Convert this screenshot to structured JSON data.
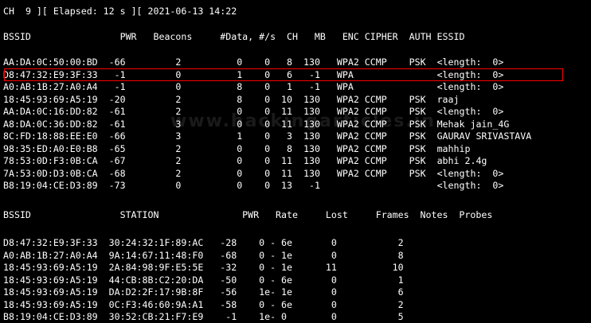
{
  "status": {
    "channel_label": "CH",
    "channel": "9",
    "elapsed_label": "Elapsed:",
    "elapsed": "12 s",
    "timestamp": "2021-06-13 14:22"
  },
  "ap_table": {
    "headers": [
      "BSSID",
      "PWR",
      "Beacons",
      "#Data,",
      "#/s",
      "CH",
      "MB",
      "ENC",
      "CIPHER",
      "AUTH",
      "ESSID"
    ],
    "rows": [
      [
        "AA:DA:0C:50:00:BD",
        "-66",
        "2",
        "0",
        "0",
        "8",
        "130",
        "WPA2",
        "CCMP",
        "PSK",
        "<length:  0>"
      ],
      [
        "D8:47:32:E9:3F:33",
        "-1",
        "0",
        "1",
        "0",
        "6",
        "-1",
        "WPA",
        "",
        "",
        "<length:  0>"
      ],
      [
        "A0:AB:1B:27:A0:A4",
        "-1",
        "0",
        "8",
        "0",
        "1",
        "-1",
        "WPA",
        "",
        "",
        "<length:  0>"
      ],
      [
        "18:45:93:69:A5:19",
        "-20",
        "2",
        "8",
        "0",
        "10",
        "130",
        "WPA2",
        "CCMP",
        "PSK",
        "raaj"
      ],
      [
        "AA:DA:0C:16:DD:82",
        "-61",
        "2",
        "0",
        "0",
        "11",
        "130",
        "WPA2",
        "CCMP",
        "PSK",
        "<length:  0>"
      ],
      [
        "A8:DA:0C:36:DD:82",
        "-61",
        "3",
        "0",
        "0",
        "11",
        "130",
        "WPA2",
        "CCMP",
        "PSK",
        "Mehak jain_4G"
      ],
      [
        "8C:FD:18:88:EE:E0",
        "-66",
        "3",
        "1",
        "0",
        "3",
        "130",
        "WPA2",
        "CCMP",
        "PSK",
        "GAURAV SRIVASTAVA"
      ],
      [
        "98:35:ED:A0:E0:B8",
        "-65",
        "2",
        "0",
        "0",
        "8",
        "130",
        "WPA2",
        "CCMP",
        "PSK",
        "mahhip"
      ],
      [
        "78:53:0D:F3:0B:CA",
        "-67",
        "2",
        "0",
        "0",
        "11",
        "130",
        "WPA2",
        "CCMP",
        "PSK",
        "abhi 2.4g"
      ],
      [
        "7A:53:0D:D3:0B:CA",
        "-68",
        "2",
        "0",
        "0",
        "11",
        "130",
        "WPA2",
        "CCMP",
        "PSK",
        "<length:  0>"
      ],
      [
        "B8:19:04:CE:D3:89",
        "-73",
        "0",
        "0",
        "0",
        "13",
        "-1",
        "",
        "",
        "",
        "<length:  0>"
      ]
    ]
  },
  "station_table": {
    "headers": [
      "BSSID",
      "STATION",
      "PWR",
      "Rate",
      "Lost",
      "Frames",
      "Notes",
      "Probes"
    ],
    "rows": [
      [
        "D8:47:32:E9:3F:33",
        "30:24:32:1F:89:AC",
        "-28",
        "0 - 6e",
        "0",
        "2"
      ],
      [
        "A0:AB:1B:27:A0:A4",
        "9A:14:67:11:48:F0",
        "-68",
        "0 - 1e",
        "0",
        "8"
      ],
      [
        "18:45:93:69:A5:19",
        "2A:84:98:9F:E5:5E",
        "-32",
        "0 - 1e",
        "11",
        "10"
      ],
      [
        "18:45:93:69:A5:19",
        "44:CB:8B:C2:20:DA",
        "-50",
        "0 - 6e",
        "0",
        "1"
      ],
      [
        "18:45:93:69:A5:19",
        "DA:D2:2F:17:9B:8F",
        "-56",
        "1e- 1e",
        "0",
        "6"
      ],
      [
        "18:45:93:69:A5:19",
        "0C:F3:46:60:9A:A1",
        "-58",
        "0 - 6e",
        "0",
        "2"
      ],
      [
        "B8:19:04:CE:D3:89",
        "30:52:CB:21:F7:E9",
        "-1",
        "1e- 0",
        "0",
        "5"
      ]
    ]
  },
  "watermark": "www.hackingarticles.in",
  "colors": {
    "background": "#000000",
    "text": "#ffffff",
    "highlight": "#ff0000"
  }
}
